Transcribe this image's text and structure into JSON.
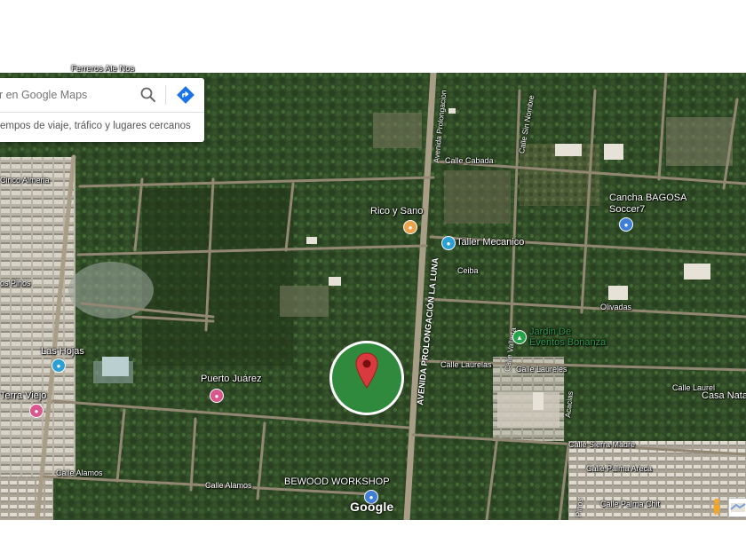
{
  "search": {
    "placeholder": "ar en Google Maps",
    "hint": "empos de viaje, tráfico y lugares cercanos"
  },
  "icons": {
    "search": "search-icon",
    "directions": "directions-icon",
    "location_pin": "location-pin-icon",
    "pegman": "pegman-icon"
  },
  "colors": {
    "marker_red": "#d93a3e",
    "marker_ring_fill": "#2f8a3d",
    "poi_blue": "#3f7fd6",
    "poi_green": "#26a24a",
    "poi_orange": "#e9a34b",
    "poi_pink": "#d8578d",
    "poi_teal": "#2c9fd3"
  },
  "places": {
    "rico_y_sano": "Rico y Sano",
    "taller": "Taller Mecanico",
    "cancha_1": "Cancha BAGOSA",
    "cancha_2": "Soccer7",
    "jardin_1": "Jardin De",
    "jardin_2": "Eventos Bonanza",
    "las_hojas": "Las Hojas",
    "terra_viejo": "Terra Viejo",
    "puerto": "Puerto Juárez",
    "bewood": "BEWOOD WORKSHOP",
    "casa": "Casa Nata"
  },
  "streets": {
    "avenida": "AVENIDA PROLONGACIÓN LA LUNA",
    "avenida_upper": "Avenida Prolongacion",
    "cinco_almeria": "Cinco Almeria",
    "sin_nombre": "Calle Sin Nombre",
    "calle_cabada": "Calle Cabada",
    "ceiba": "Ceiba",
    "olivadas": "Olivadas",
    "calle_laurelas": "Calle Laurelas",
    "calle_laureles": "Calle Laureles",
    "calle_vallarta": "Calle Vallarta",
    "calle_laurel": "Calle Laurel",
    "sierra_madre": "Calle Sierra Madre",
    "palma_areca": "Calle Palma Areca",
    "palma_chit": "Calle Palma Chit",
    "calle_alamos_1": "Calle Alamos",
    "calle_alamos_2": "Calle Alamos",
    "acacias": "Acacias",
    "pinos": "Pinos",
    "los_pinos": "os Pinos",
    "ferreros": "Ferreros Ale Nos"
  },
  "attribution": {
    "logo": "Google"
  }
}
